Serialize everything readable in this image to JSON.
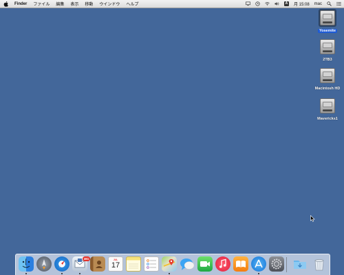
{
  "menubar": {
    "app_name": "Finder",
    "items": [
      "ファイル",
      "編集",
      "表示",
      "移動",
      "ウインドウ",
      "ヘルプ"
    ],
    "input_source": "A",
    "clock": "月 15:08",
    "user": "mac"
  },
  "desktop": {
    "drives": [
      {
        "label": "Yosemite",
        "selected": true
      },
      {
        "label": "2TB3",
        "selected": false
      },
      {
        "label": "Macintosh HD",
        "selected": false
      },
      {
        "label": "Mavericks1",
        "selected": false
      }
    ]
  },
  "dock": {
    "mail_badge": "461",
    "calendar_month": "JUL",
    "calendar_day": "17",
    "apps": [
      "finder-icon",
      "launchpad-icon",
      "safari-icon",
      "mail-icon",
      "contacts-icon",
      "calendar-icon",
      "notes-icon",
      "reminders-icon",
      "maps-icon",
      "messages-icon",
      "facetime-icon",
      "itunes-icon",
      "ibooks-icon",
      "app-store-icon",
      "system-preferences-icon",
      "downloads-folder-icon",
      "trash-icon"
    ]
  },
  "colors": {
    "desktop": "#43679a",
    "selection": "#1e5bd6"
  }
}
